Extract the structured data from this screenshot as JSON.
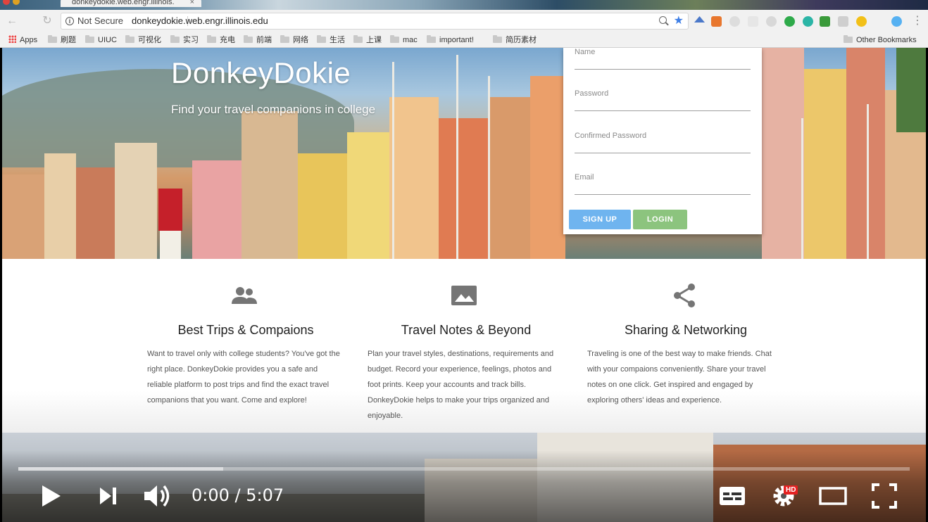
{
  "browser": {
    "tab_title": "donkeydokie.web.engr.illinois.",
    "security_label": "Not Secure",
    "url": "donkeydokie.web.engr.illinois.edu",
    "bookmarks": [
      {
        "label": "Apps",
        "icon": "apps-grid-icon"
      },
      {
        "label": "刷题",
        "icon": "folder-icon"
      },
      {
        "label": "UIUC",
        "icon": "folder-icon"
      },
      {
        "label": "可视化",
        "icon": "folder-icon"
      },
      {
        "label": "实习",
        "icon": "folder-icon"
      },
      {
        "label": "充电",
        "icon": "folder-icon"
      },
      {
        "label": "前端",
        "icon": "folder-icon"
      },
      {
        "label": "网络",
        "icon": "folder-icon"
      },
      {
        "label": "生活",
        "icon": "folder-icon"
      },
      {
        "label": "上课",
        "icon": "folder-icon"
      },
      {
        "label": "mac",
        "icon": "folder-icon"
      },
      {
        "label": "important!",
        "icon": "folder-icon"
      },
      {
        "label": "简历素材",
        "icon": "folder-icon"
      }
    ],
    "other_bookmarks": "Other Bookmarks"
  },
  "hero": {
    "brand": "DonkeyDokie",
    "tagline": "Find your travel companions in college"
  },
  "signup_form": {
    "fields": [
      {
        "label": "Name"
      },
      {
        "label": "Password"
      },
      {
        "label": "Confirmed Password"
      },
      {
        "label": "Email"
      }
    ],
    "signup_button": "SIGN UP",
    "login_button": "LOGIN",
    "colors": {
      "signup": "#6fb4ef",
      "login": "#8cc47e"
    }
  },
  "features": [
    {
      "icon": "people-icon",
      "title": "Best Trips & Compaions",
      "body": "Want to travel only with college students? You've got the right place. DonkeyDokie provides you a safe and reliable platform to post trips and find the exact travel companions that you want. Come and explore!"
    },
    {
      "icon": "image-icon",
      "title": "Travel Notes & Beyond",
      "body": "Plan your travel styles, destinations, requirements and budget. Record your experience, feelings, photos and foot prints. Keep your accounts and track bills. DonkeyDokie helps to make your trips organized and enjoyable."
    },
    {
      "icon": "share-icon",
      "title": "Sharing & Networking",
      "body": "Traveling is one of the best way to make friends. Chat with your compaions conveniently. Share your travel notes on one click. Get inspired and engaged by exploring others' ideas and experience."
    }
  ],
  "video": {
    "time": "0:00 / 5:07",
    "quality_badge": "HD",
    "buffered_fraction": 0.23
  }
}
